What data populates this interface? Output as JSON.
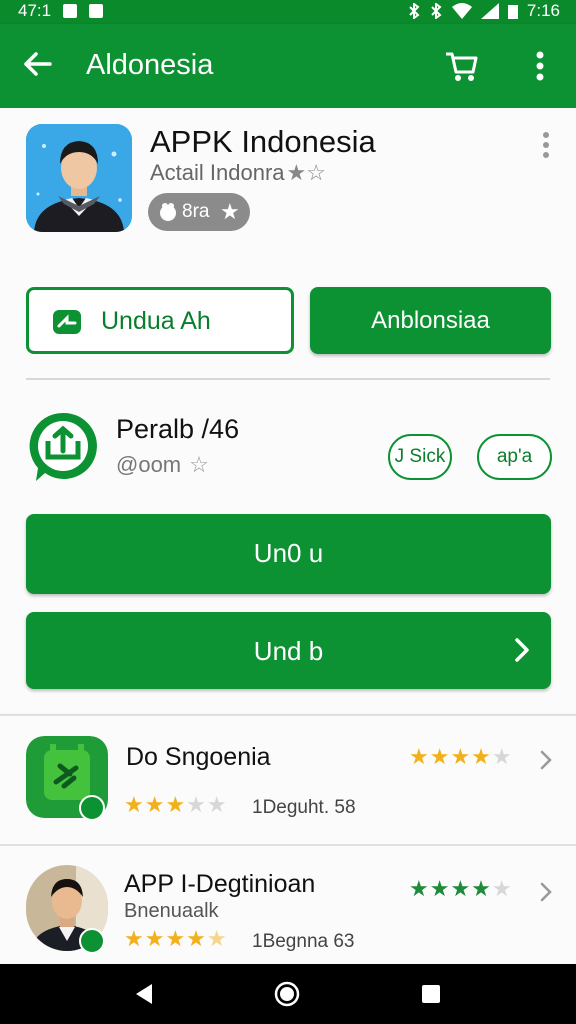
{
  "status_bar": {
    "time_left": "47:1",
    "time_right": "7:16"
  },
  "app_bar": {
    "title": "Aldonesia",
    "back_icon": "arrow-left-icon",
    "cart_icon": "cart-icon",
    "more_icon": "more-vert-icon"
  },
  "colors": {
    "primary": "#0c9233",
    "primary_dark": "#0b8a2c",
    "star_gold": "#f2b11b",
    "star_green": "#1f8a3a"
  },
  "app": {
    "title": "APPK Indonesia",
    "subtitle": "Actail Indonra",
    "subtitle_stars": "★☆",
    "rating": "8ra",
    "rating_star": "★",
    "install_label": "Undua Ah",
    "open_label": "Anblonsiaa"
  },
  "publisher": {
    "title": "Peralb /46",
    "subtitle": "@oom",
    "subtitle_star": "☆",
    "chip1": "J Sick",
    "chip2": "ap'a"
  },
  "actions": {
    "primary": "Un0 u",
    "secondary": "Und b"
  },
  "list": [
    {
      "title": "Do Sngoenia",
      "stars_top": "★★★★★",
      "stars_bottom": "★★★★★",
      "meta": "1Deguht. 58",
      "icon": "chat-app-icon"
    },
    {
      "title": "APP I-Degtinioan",
      "subtitle": "Bnenuaalk",
      "stars_top": "★★★★★",
      "stars_bottom": "★★★★★",
      "meta": "1Begnna 63",
      "icon": "person-avatar-icon"
    }
  ]
}
